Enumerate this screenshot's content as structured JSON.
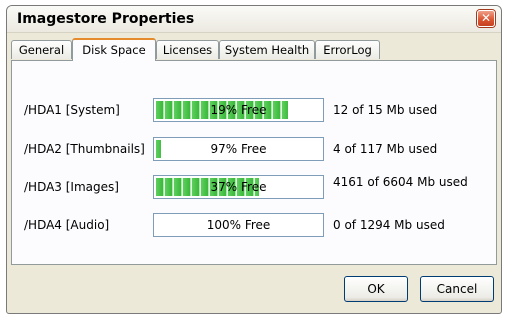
{
  "window": {
    "title": "Imagestore Properties",
    "close_glyph": "✕"
  },
  "tabs": [
    {
      "label": "General"
    },
    {
      "label": "Disk Space",
      "active": true
    },
    {
      "label": "Licenses"
    },
    {
      "label": "System Health"
    },
    {
      "label": "ErrorLog"
    }
  ],
  "disks": [
    {
      "label": "/HDA1 [System]",
      "free_text": "19% Free",
      "used_fraction": 0.81,
      "usage": "12 of 15 Mb used"
    },
    {
      "label": "/HDA2 [Thumbnails]",
      "free_text": "97% Free",
      "used_fraction": 0.03,
      "usage": "4 of 117 Mb used"
    },
    {
      "label": "/HDA3 [Images]",
      "free_text": "37% Free",
      "used_fraction": 0.63,
      "usage": "4161 of 6604 Mb used"
    },
    {
      "label": "/HDA4 [Audio]",
      "free_text": "100% Free",
      "used_fraction": 0.0,
      "usage": "0 of 1294 Mb used"
    }
  ],
  "buttons": {
    "ok": "OK",
    "cancel": "Cancel"
  },
  "colors": {
    "bar_fill": "#3ab83a",
    "active_tab_accent": "#e68b2c",
    "close_button": "#d9532f"
  }
}
